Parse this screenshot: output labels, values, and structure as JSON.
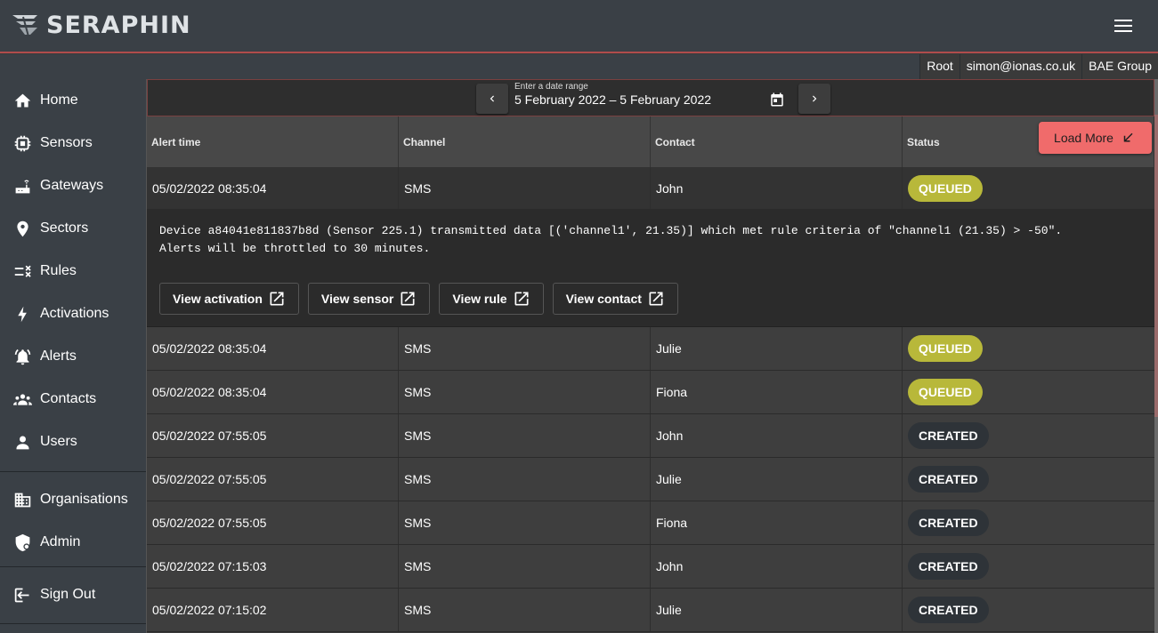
{
  "app": {
    "logo_text": "SERAPHIN"
  },
  "userbar": {
    "role": "Root",
    "email": "simon@ionas.co.uk",
    "organisation": "BAE Group"
  },
  "sidebar": {
    "items": [
      {
        "label": "Home",
        "icon": "home-icon"
      },
      {
        "label": "Sensors",
        "icon": "chip-icon"
      },
      {
        "label": "Gateways",
        "icon": "router-icon"
      },
      {
        "label": "Sectors",
        "icon": "location-pin-icon"
      },
      {
        "label": "Rules",
        "icon": "rule-icon"
      },
      {
        "label": "Activations",
        "icon": "lightning-icon"
      },
      {
        "label": "Alerts",
        "icon": "bell-icon"
      },
      {
        "label": "Contacts",
        "icon": "group-icon"
      },
      {
        "label": "Users",
        "icon": "person-icon"
      }
    ],
    "admin_items": [
      {
        "label": "Organisations",
        "icon": "building-icon"
      },
      {
        "label": "Admin",
        "icon": "shield-icon"
      }
    ],
    "signout": {
      "label": "Sign Out",
      "icon": "logout-icon"
    }
  },
  "datebar": {
    "label": "Enter a date range",
    "value": "5 February 2022 – 5 February 2022"
  },
  "table": {
    "headers": [
      "Alert time",
      "Channel",
      "Contact",
      "Status"
    ],
    "load_more": "Load More",
    "expanded": {
      "alert_time": "05/02/2022 08:35:04",
      "channel": "SMS",
      "contact": "John",
      "status": "QUEUED",
      "message": "Device a84041e811837b8d (Sensor 225.1) transmitted data [('channel1', 21.35)] which met rule criteria of \"channel1 (21.35) > -50\".\nAlerts will be throttled to 30 minutes.",
      "actions": [
        "View activation",
        "View sensor",
        "View rule",
        "View contact"
      ]
    },
    "rows": [
      {
        "alert_time": "05/02/2022 08:35:04",
        "channel": "SMS",
        "contact": "Julie",
        "status": "QUEUED"
      },
      {
        "alert_time": "05/02/2022 08:35:04",
        "channel": "SMS",
        "contact": "Fiona",
        "status": "QUEUED"
      },
      {
        "alert_time": "05/02/2022 07:55:05",
        "channel": "SMS",
        "contact": "John",
        "status": "CREATED"
      },
      {
        "alert_time": "05/02/2022 07:55:05",
        "channel": "SMS",
        "contact": "Julie",
        "status": "CREATED"
      },
      {
        "alert_time": "05/02/2022 07:55:05",
        "channel": "SMS",
        "contact": "Fiona",
        "status": "CREATED"
      },
      {
        "alert_time": "05/02/2022 07:15:03",
        "channel": "SMS",
        "contact": "John",
        "status": "CREATED"
      },
      {
        "alert_time": "05/02/2022 07:15:02",
        "channel": "SMS",
        "contact": "Julie",
        "status": "CREATED"
      }
    ]
  },
  "colors": {
    "accent": "#f06b6b",
    "queued": "#b8b83a",
    "created": "#2e3338",
    "sidebar": "#3a4046"
  }
}
